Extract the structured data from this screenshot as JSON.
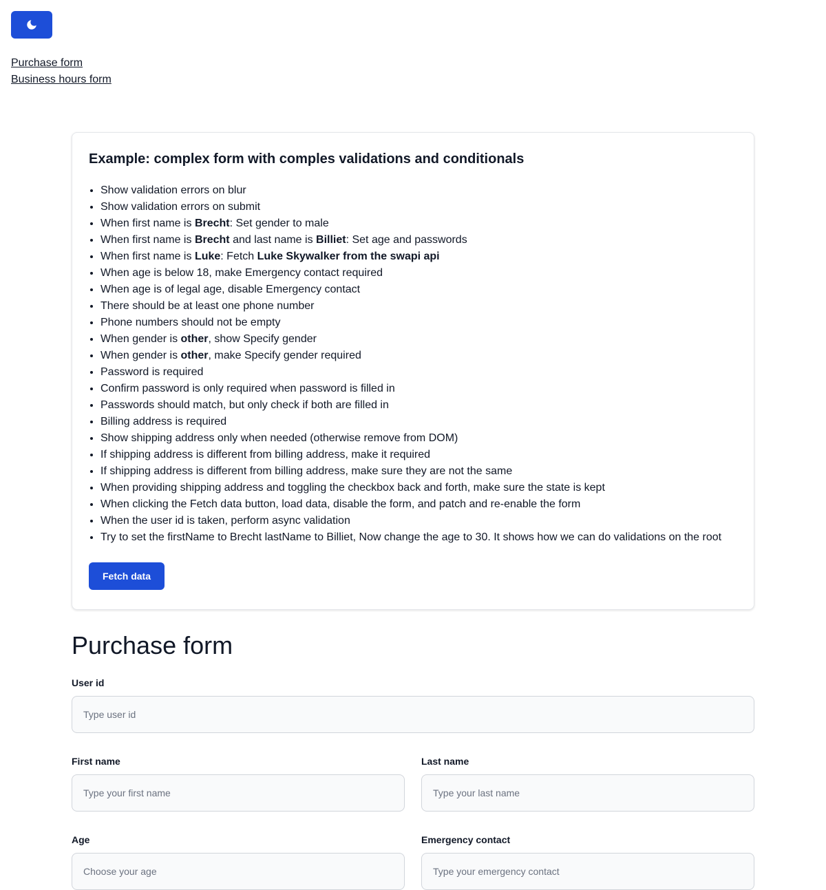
{
  "header": {
    "theme_toggle_icon": "moon-icon",
    "accent_color": "#1d4ed8",
    "nav_links": [
      "Purchase form",
      "Business hours form"
    ]
  },
  "card": {
    "title": "Example: complex form with comples validations and conditionals",
    "items": [
      [
        {
          "t": "Show validation errors on blur"
        }
      ],
      [
        {
          "t": "Show validation errors on submit"
        }
      ],
      [
        {
          "t": "When first name is "
        },
        {
          "t": "Brecht",
          "b": true
        },
        {
          "t": ": Set gender to male"
        }
      ],
      [
        {
          "t": "When first name is "
        },
        {
          "t": "Brecht",
          "b": true
        },
        {
          "t": " and last name is "
        },
        {
          "t": "Billiet",
          "b": true
        },
        {
          "t": ": Set age and passwords"
        }
      ],
      [
        {
          "t": "When first name is "
        },
        {
          "t": "Luke",
          "b": true
        },
        {
          "t": ": Fetch "
        },
        {
          "t": "Luke Skywalker from the swapi api",
          "b": true
        }
      ],
      [
        {
          "t": "When age is below 18, make Emergency contact required"
        }
      ],
      [
        {
          "t": "When age is of legal age, disable Emergency contact"
        }
      ],
      [
        {
          "t": "There should be at least one phone number"
        }
      ],
      [
        {
          "t": "Phone numbers should not be empty"
        }
      ],
      [
        {
          "t": "When gender is "
        },
        {
          "t": "other",
          "b": true
        },
        {
          "t": ", show Specify gender"
        }
      ],
      [
        {
          "t": "When gender is "
        },
        {
          "t": "other",
          "b": true
        },
        {
          "t": ", make Specify gender required"
        }
      ],
      [
        {
          "t": "Password is required"
        }
      ],
      [
        {
          "t": "Confirm password is only required when password is filled in"
        }
      ],
      [
        {
          "t": "Passwords should match, but only check if both are filled in"
        }
      ],
      [
        {
          "t": "Billing address is required"
        }
      ],
      [
        {
          "t": "Show shipping address only when needed (otherwise remove from DOM)"
        }
      ],
      [
        {
          "t": "If shipping address is different from billing address, make it required"
        }
      ],
      [
        {
          "t": "If shipping address is different from billing address, make sure they are not the same"
        }
      ],
      [
        {
          "t": "When providing shipping address and toggling the checkbox back and forth, make sure the state is kept"
        }
      ],
      [
        {
          "t": "When clicking the Fetch data button, load data, disable the form, and patch and re-enable the form"
        }
      ],
      [
        {
          "t": "When the user id is taken, perform async validation"
        }
      ],
      [
        {
          "t": "Try to set the firstName to Brecht lastName to Billiet, Now change the age to 30. It shows how we can do validations on the root"
        }
      ]
    ],
    "fetch_button_label": "Fetch data"
  },
  "form": {
    "title": "Purchase form",
    "user_id": {
      "label": "User id",
      "placeholder": "Type user id",
      "value": ""
    },
    "first_name": {
      "label": "First name",
      "placeholder": "Type your first name",
      "value": ""
    },
    "last_name": {
      "label": "Last name",
      "placeholder": "Type your last name",
      "value": ""
    },
    "age": {
      "label": "Age",
      "placeholder": "Choose your age",
      "value": ""
    },
    "emergency_contact": {
      "label": "Emergency contact",
      "placeholder": "Type your emergency contact",
      "value": ""
    }
  }
}
